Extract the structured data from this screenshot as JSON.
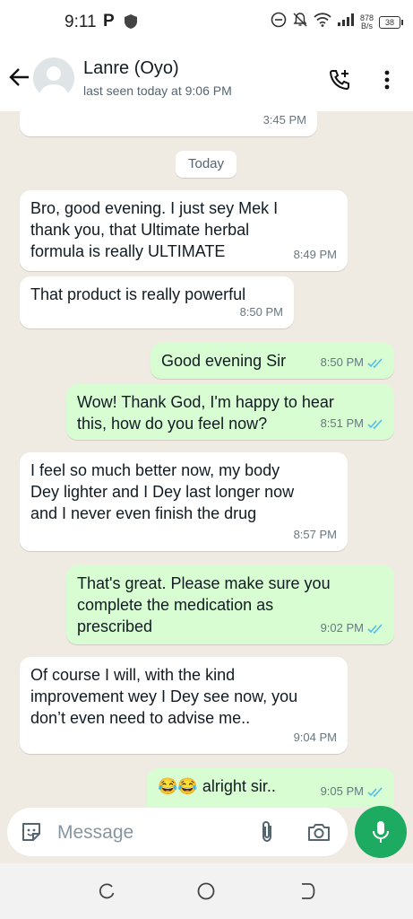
{
  "status_bar": {
    "time": "9:11",
    "p_icon": "P",
    "net_speed_value": "878",
    "net_speed_unit": "B/s",
    "battery": "38"
  },
  "header": {
    "contact_name": "Lanre (Oyo)",
    "last_seen": "last seen today at 9:06 PM"
  },
  "chat": {
    "prev_time": "3:45 PM",
    "day_label": "Today",
    "messages": [
      {
        "direction": "in",
        "lines": [
          "Bro, good evening. I just sey Mek I",
          "thank you, that Ultimate herbal",
          "formula is really ULTIMATE"
        ],
        "time": "8:49 PM"
      },
      {
        "direction": "in",
        "lines": [
          "That product is really powerful"
        ],
        "time": "8:50 PM"
      },
      {
        "direction": "out",
        "lines": [
          "Good evening Sir"
        ],
        "time": "8:50 PM",
        "read": true
      },
      {
        "direction": "out",
        "lines": [
          "Wow! Thank God, I'm happy to hear",
          "this, how do you feel now?"
        ],
        "time": "8:51 PM",
        "read": true
      },
      {
        "direction": "in",
        "lines": [
          "I feel so much better now, my body",
          "Dey lighter and I Dey last longer now",
          "and I never even finish the drug"
        ],
        "time": "8:57 PM"
      },
      {
        "direction": "out",
        "lines": [
          "That's great. Please make sure you",
          "complete the medication as",
          "prescribed"
        ],
        "time": "9:02 PM",
        "read": true
      },
      {
        "direction": "in",
        "lines": [
          "Of course I will, with the kind",
          "improvement wey I Dey see now, you",
          "don’t even need to advise me.."
        ],
        "time": "9:04 PM"
      },
      {
        "direction": "out",
        "lines": [
          "😂😂 alright sir.."
        ],
        "time": "9:05 PM",
        "read": true
      }
    ]
  },
  "input": {
    "placeholder": "Message"
  },
  "colors": {
    "chat_bg": "#efeae2",
    "incoming_bubble": "#ffffff",
    "outgoing_bubble": "#d9fdd3",
    "read_ticks": "#53bdeb",
    "mic_button": "#1daa61"
  }
}
